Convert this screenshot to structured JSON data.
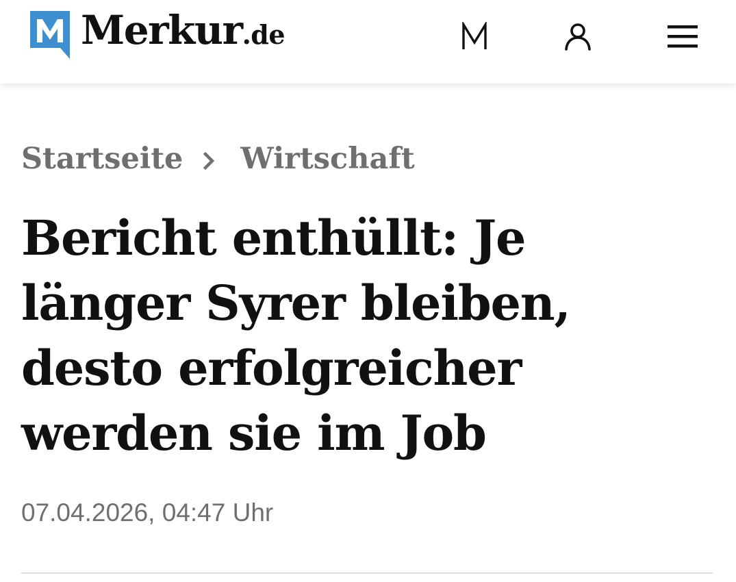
{
  "header": {
    "logo": {
      "word": "Merkur",
      "tld": ".de",
      "mark_letter": "M",
      "mark_color": "#3d8fd0"
    },
    "icons": {
      "premium": "m-brand-icon",
      "account": "user-icon",
      "menu": "hamburger-menu-icon"
    }
  },
  "breadcrumb": {
    "items": [
      {
        "label": "Startseite"
      },
      {
        "label": "Wirtschaft"
      }
    ],
    "separator_icon": "chevron-right-icon"
  },
  "article": {
    "headline": "Bericht enthüllt: Je länger Syrer bleiben, desto erfolgreicher werden sie im Job",
    "date": "07.04.2026, 04:47 Uhr"
  },
  "colors": {
    "text": "#111111",
    "muted": "#6f6f6f",
    "brand_blue": "#3d8fd0",
    "divider": "#dcdcdc"
  }
}
